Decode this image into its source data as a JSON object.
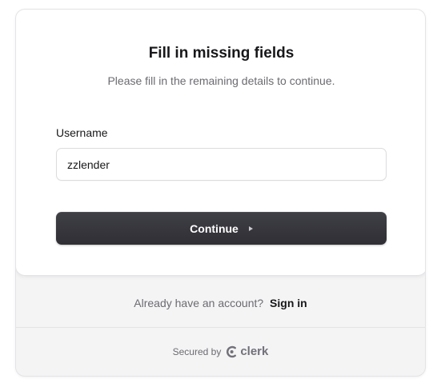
{
  "form": {
    "title": "Fill in missing fields",
    "subtitle": "Please fill in the remaining details to continue.",
    "username_label": "Username",
    "username_value": "zzlender",
    "continue_label": "Continue"
  },
  "footer": {
    "already_text": "Already have an account?",
    "signin_label": "Sign in",
    "secured_text": "Secured by",
    "brand": "clerk",
    "brand_icon": "clerk-logo-icon"
  },
  "colors": {
    "button_bg": "#2f2f35",
    "text_primary": "#18181b",
    "text_muted": "#6b6b72",
    "footer_bg": "#f4f4f5"
  }
}
